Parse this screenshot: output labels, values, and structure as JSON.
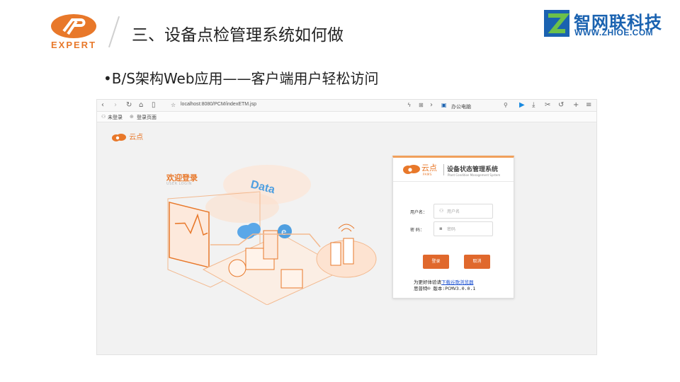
{
  "slide": {
    "title": "三、设备点检管理系统如何做",
    "bullet": "•B/S架构Web应用——客户端用户轻松访问",
    "left_logo_text": "EXPERT",
    "right_logo_cn": "智网联科技",
    "right_logo_url": "WWW.ZHIOE.COM"
  },
  "browser": {
    "url": "localhost:8080/PCM/indexETM.jsp",
    "tab_label": "办公电脑",
    "bookmarks": [
      "未登录",
      "登录页面"
    ]
  },
  "page": {
    "small_logo": "云点",
    "welcome_title": "欢迎登录",
    "welcome_sub": "USER LOGIN",
    "illustration_label": "Data"
  },
  "login": {
    "brand": "云点",
    "brand_sub": "PAMS",
    "system_title": "设备状态管理系统",
    "system_subtitle": "Plant Condition Management System",
    "username_label": "用户名：",
    "username_placeholder": "用户名",
    "password_label": "密  码：",
    "password_placeholder": "密码",
    "login_button": "登录",
    "cancel_button": "取消",
    "hint_text": "为更好体验请",
    "hint_link": "下载谷歌浏览器",
    "version_text": "思普特® 版本:PCMV3.0.0.1"
  },
  "colors": {
    "accent": "#e8782a",
    "button": "#e0682c",
    "brand_blue": "#1a62b0"
  },
  "icons": [
    "back-icon",
    "forward-icon",
    "refresh-icon",
    "home-icon",
    "reader-icon",
    "star-icon",
    "flash-icon",
    "grid-icon",
    "search-icon",
    "play-icon",
    "download-icon",
    "cut-icon",
    "undo-icon",
    "plus-icon",
    "menu-icon",
    "user-icon",
    "globe-icon",
    "lock-icon"
  ]
}
